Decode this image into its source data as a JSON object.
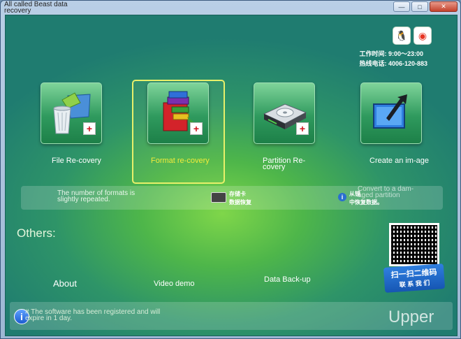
{
  "window": {
    "title": "All called Beast data recovery",
    "controls": {
      "minimize": "—",
      "maximize": "□",
      "close": "✕"
    }
  },
  "header": {
    "social": [
      {
        "icon": "qq-penguin-icon",
        "glyph": "🐧"
      },
      {
        "icon": "weibo-icon",
        "glyph": "◉"
      }
    ],
    "work_hours": "工作时间: 9:00～23:00",
    "hotline": "热线电话: 4006-120-883"
  },
  "tiles": [
    {
      "id": "file-recovery",
      "label": "File Re-covery",
      "icon": "recycle-bin-icon",
      "selected": false
    },
    {
      "id": "format-recovery",
      "label": "Format re-covery",
      "icon": "format-blocks-icon",
      "selected": true
    },
    {
      "id": "partition-recovery",
      "label": "Partition Re-covery",
      "icon": "hard-drive-icon",
      "selected": false
    },
    {
      "id": "create-image",
      "label": "Create an im-age",
      "icon": "arrow-screen-icon",
      "selected": false
    }
  ],
  "info_bar": {
    "format_hint": "The number of formats is slightly repeated.",
    "card_line1": "存储卡",
    "card_line2": "数据恢复",
    "partition_line1": "从镜",
    "partition_line2": "中恢复数据。",
    "image_hint": "Convert to a dam-aged partition"
  },
  "others": {
    "title": "Others:",
    "links": {
      "about": "About",
      "video_demo": "Video demo",
      "data_backup": "Data Back-up"
    }
  },
  "qr": {
    "banner_line1": "扫一扫二维码",
    "banner_line2": "联 系 我 们"
  },
  "status": {
    "message": "# The software has been registered and will expire in 1 day.",
    "upper": "Upper"
  },
  "colors": {
    "accent_selected": "#e8f06a",
    "tile_green": "#2f9a5e",
    "background_green": "#4eb64a"
  }
}
